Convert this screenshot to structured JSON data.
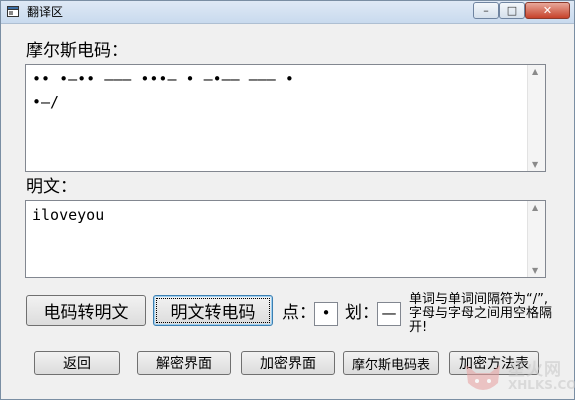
{
  "window": {
    "title": "翻译区",
    "controls": {
      "minimize": "–",
      "maximize": "□",
      "close": "✕"
    }
  },
  "morse_section": {
    "label": "摩尔斯电码：",
    "value": "•• •—•• ——— •••— • —•—— ——— •\n•—/"
  },
  "plain_section": {
    "label": "明文：",
    "value": "iloveyou"
  },
  "actions": {
    "morse_to_plain": "电码转明文",
    "plain_to_morse": "明文转电码",
    "dot_label": "点：",
    "dot_value": "•",
    "dash_label": "划：",
    "dash_value": "—",
    "hint": "单词与单词间隔符为“/”,字母与字母之间用空格隔开!"
  },
  "nav": {
    "back": "返回",
    "decrypt": "解密界面",
    "encrypt": "加密界面",
    "morse_table": "摩尔斯电码表",
    "method_table": "加密方法表"
  },
  "watermark": {
    "cn": "星火网",
    "en": "XHLKS.COM"
  }
}
